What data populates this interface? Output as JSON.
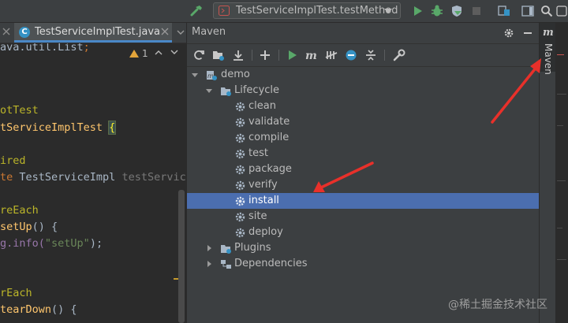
{
  "toolbar": {
    "run_config": "TestServiceImplTest.testMethod"
  },
  "editor": {
    "tab_label": "TestServiceImplTest.java",
    "warning_count": "1",
    "lines": [
      {
        "a": "",
        "b": "ava.util.List",
        "c": ";"
      },
      {
        "a": "",
        "b": "",
        "c": ""
      },
      {
        "a": "",
        "b": "",
        "c": ""
      },
      {
        "a": "otTest",
        "b": "",
        "c": ""
      },
      {
        "a": "tServiceImplTest ",
        "b": "{",
        "c": ""
      },
      {
        "a": "",
        "b": "",
        "c": ""
      },
      {
        "a": "ired",
        "b": "",
        "c": ""
      },
      {
        "a": "te ",
        "b": "TestServiceImpl ",
        "c": "testService"
      },
      {
        "a": "",
        "b": "",
        "c": ""
      },
      {
        "a": "reEach",
        "b": "",
        "c": ""
      },
      {
        "a": "setUp",
        "b": "() {",
        "c": ""
      },
      {
        "a": "g.info(",
        "b": "\"setUp\"",
        "c": ");"
      },
      {
        "a": "",
        "b": "",
        "c": ""
      },
      {
        "a": "",
        "b": "",
        "c": ""
      },
      {
        "a": "rEach",
        "b": "",
        "c": ""
      },
      {
        "a": "tearDown",
        "b": "() {",
        "c": ""
      }
    ]
  },
  "maven": {
    "title": "Maven",
    "root": "demo",
    "lifecycle": "Lifecycle",
    "goals": [
      "clean",
      "validate",
      "compile",
      "test",
      "package",
      "verify",
      "install",
      "site",
      "deploy"
    ],
    "selected_goal": "install",
    "plugins": "Plugins",
    "dependencies": "Dependencies"
  },
  "side_tab": {
    "label": "Maven",
    "glyph": "m"
  },
  "watermark": "@稀土掘金技术社区",
  "colors": {
    "selection": "#4b6eaf",
    "run_green": "#59a869",
    "annotation_arrow": "#e8302a"
  }
}
